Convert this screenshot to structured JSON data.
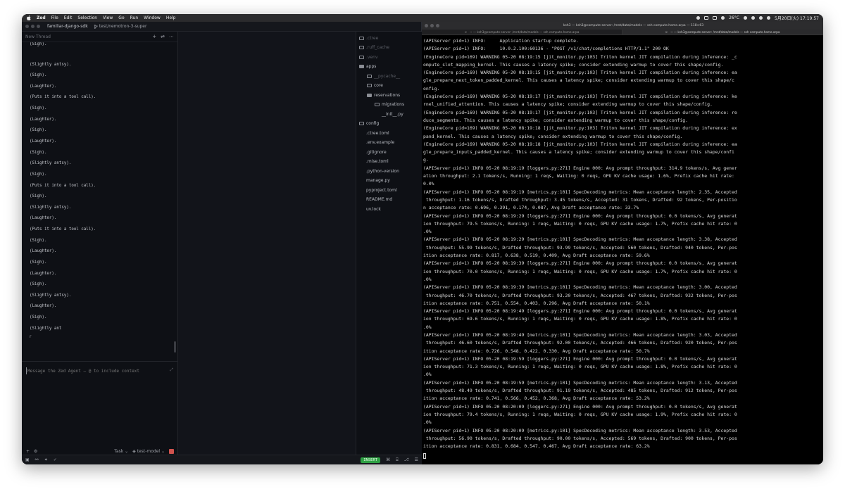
{
  "menubar": {
    "app": "Zed",
    "items": [
      "File",
      "Edit",
      "Selection",
      "View",
      "Go",
      "Run",
      "Window",
      "Help"
    ],
    "temperature": "26°C",
    "datetime": "5月20日(火) 17:19:57"
  },
  "zed": {
    "project": "familiar-django-sdk",
    "branch": "test/nemotron-3-super",
    "thread_title": "New Thread",
    "header_actions": [
      "+",
      "⇌",
      "⋯"
    ],
    "messages": [
      "(Sigh).",
      "(Slightly antsy).",
      "(Sigh).",
      "(Laughter).",
      "(Puts it into a tool call).",
      "(Sigh).",
      "(Laughter).",
      "(Sigh).",
      "(Laughter).",
      "(Sigh).",
      "(Slightly antsy).",
      "(Sigh).",
      "(Puts it into a tool call).",
      "(Sigh).",
      "(Slightly antsy).",
      "(Laughter).",
      "(Puts it into a tool call).",
      "(Sigh).",
      "(Laughter).",
      "(Sigh).",
      "(Laughter).",
      "(Sigh).",
      "(Slightly antsy).",
      "(Laughter).",
      "(Sigh).",
      "(Slightly ant"
    ],
    "cursor_glyph": "r",
    "composer_placeholder": "Message the Zed Agent — @ to include context",
    "footer": {
      "mode": "Task",
      "model": "test-model"
    },
    "project_tree": [
      {
        "name": ".ctree",
        "type": "folder",
        "dim": true,
        "depth": 0
      },
      {
        "name": ".ruff_cache",
        "type": "folder",
        "dim": true,
        "depth": 0
      },
      {
        "name": ".venv",
        "type": "folder",
        "dim": true,
        "depth": 0
      },
      {
        "name": "apps",
        "type": "folder-open",
        "dim": false,
        "depth": 0
      },
      {
        "name": "__pycache__",
        "type": "folder",
        "dim": true,
        "depth": 1
      },
      {
        "name": "core",
        "type": "folder",
        "dim": false,
        "depth": 1
      },
      {
        "name": "reservations",
        "type": "folder-open",
        "dim": false,
        "depth": 1
      },
      {
        "name": "migrations",
        "type": "folder",
        "dim": false,
        "depth": 2
      },
      {
        "name": "__init__.py",
        "type": "file",
        "dim": false,
        "depth": 2
      },
      {
        "name": "config",
        "type": "folder",
        "dim": false,
        "depth": 0
      },
      {
        "name": ".ctree.toml",
        "type": "file",
        "dim": false,
        "depth": 0
      },
      {
        "name": ".env.example",
        "type": "file",
        "dim": false,
        "depth": 0
      },
      {
        "name": ".gitignore",
        "type": "file",
        "dim": false,
        "depth": 0
      },
      {
        "name": ".mise.toml",
        "type": "file",
        "dim": false,
        "depth": 0
      },
      {
        "name": ".python-version",
        "type": "file",
        "dim": false,
        "depth": 0
      },
      {
        "name": "manage.py",
        "type": "file",
        "dim": false,
        "depth": 0
      },
      {
        "name": "pyproject.toml",
        "type": "file",
        "dim": false,
        "depth": 0
      },
      {
        "name": "README.md",
        "type": "file",
        "dim": false,
        "depth": 0
      },
      {
        "name": "uv.lock",
        "type": "file",
        "dim": false,
        "depth": 0
      }
    ],
    "status": {
      "mode": "INSERT"
    }
  },
  "terminal": {
    "window_title": "ksh3 — ksh3@compute-server: /mnt/data/models — ssh compute.home.arpa — 118×63",
    "tabs": [
      "~ — ksh3@compute-server: /mnt/data/models — ssh compute.home.arpa",
      "~ — ksh3@compute-server: /mnt/data/models — ssh compute.home.arpa"
    ],
    "lines": [
      "(APIServer pid=1) INFO:     Application startup complete.",
      "(APIServer pid=1) INFO:     10.0.2.100:60136 - \"POST /v1/chat/completions HTTP/1.1\" 200 OK",
      "(EngineCore pid=169) WARNING 05-20 08:19:15 [jit_monitor.py:103] Triton kernel JIT compilation during inference: _c",
      "ompute_slot_mapping_kernel. This causes a latency spike; consider extending warmup to cover this shape/config.",
      "(EngineCore pid=169) WARNING 05-20 08:19:15 [jit_monitor.py:103] Triton kernel JIT compilation during inference: ea",
      "gle_prepare_next_token_padded_kernel. This causes a latency spike; consider extending warmup to cover this shape/c",
      "onfig.",
      "(EngineCore pid=169) WARNING 05-20 08:19:17 [jit_monitor.py:103] Triton kernel JIT compilation during inference: ke",
      "rnel_unified_attention. This causes a latency spike; consider extending warmup to cover this shape/config.",
      "(EngineCore pid=169) WARNING 05-20 08:19:17 [jit_monitor.py:103] Triton kernel JIT compilation during inference: re",
      "duce_segments. This causes a latency spike; consider extending warmup to cover this shape/config.",
      "(EngineCore pid=169) WARNING 05-20 08:19:18 [jit_monitor.py:103] Triton kernel JIT compilation during inference: ex",
      "pand_kernel. This causes a latency spike; consider extending warmup to cover this shape/config.",
      "(EngineCore pid=169) WARNING 05-20 08:19:18 [jit_monitor.py:103] Triton kernel JIT compilation during inference: ea",
      "gle_prepare_inputs_padded_kernel. This causes a latency spike; consider extending warmup to cover this shape/confi",
      "g.",
      "(APIServer pid=1) INFO 05-20 08:19:19 [loggers.py:271] Engine 000: Avg prompt throughput: 314.9 tokens/s, Avg gener",
      "ation throughput: 2.1 tokens/s, Running: 1 reqs, Waiting: 0 reqs, GPU KV cache usage: 1.6%, Prefix cache hit rate:",
      "0.0%",
      "(APIServer pid=1) INFO 05-20 08:19:19 [metrics.py:101] SpecDecoding metrics: Mean acceptance length: 2.35, Accepted",
      " throughput: 1.16 tokens/s, Drafted throughput: 3.45 tokens/s, Accepted: 31 tokens, Drafted: 92 tokens, Per-positio",
      "n acceptance rate: 0.696, 0.391, 0.174, 0.087, Avg Draft acceptance rate: 33.7%",
      "(APIServer pid=1) INFO 05-20 08:19:29 [loggers.py:271] Engine 000: Avg prompt throughput: 0.0 tokens/s, Avg generat",
      "ion throughput: 79.5 tokens/s, Running: 1 reqs, Waiting: 0 reqs, GPU KV cache usage: 1.7%, Prefix cache hit rate: 0",
      ".0%",
      "(APIServer pid=1) INFO 05-20 08:19:29 [metrics.py:101] SpecDecoding metrics: Mean acceptance length: 3.38, Accepted",
      " throughput: 55.99 tokens/s, Drafted throughput: 93.99 tokens/s, Accepted: 560 tokens, Drafted: 940 tokens, Per-pos",
      "ition acceptance rate: 0.817, 0.638, 0.519, 0.409, Avg Draft acceptance rate: 59.6%",
      "(APIServer pid=1) INFO 05-20 08:19:39 [loggers.py:271] Engine 000: Avg prompt throughput: 0.0 tokens/s, Avg generat",
      "ion throughput: 70.0 tokens/s, Running: 1 reqs, Waiting: 0 reqs, GPU KV cache usage: 1.7%, Prefix cache hit rate: 0",
      ".0%",
      "(APIServer pid=1) INFO 05-20 08:19:39 [metrics.py:101] SpecDecoding metrics: Mean acceptance length: 3.00, Accepted",
      " throughput: 46.70 tokens/s, Drafted throughput: 93.20 tokens/s, Accepted: 467 tokens, Drafted: 932 tokens, Per-pos",
      "ition acceptance rate: 0.751, 0.554, 0.403, 0.296, Avg Draft acceptance rate: 50.1%",
      "(APIServer pid=1) INFO 05-20 08:19:49 [loggers.py:271] Engine 000: Avg prompt throughput: 0.0 tokens/s, Avg generat",
      "ion throughput: 69.6 tokens/s, Running: 1 reqs, Waiting: 0 reqs, GPU KV cache usage: 1.8%, Prefix cache hit rate: 0",
      ".0%",
      "(APIServer pid=1) INFO 05-20 08:19:49 [metrics.py:101] SpecDecoding metrics: Mean acceptance length: 3.03, Accepted",
      " throughput: 46.60 tokens/s, Drafted throughput: 92.00 tokens/s, Accepted: 466 tokens, Drafted: 920 tokens, Per-pos",
      "ition acceptance rate: 0.726, 0.548, 0.422, 0.330, Avg Draft acceptance rate: 50.7%",
      "(APIServer pid=1) INFO 05-20 08:19:59 [loggers.py:271] Engine 000: Avg prompt throughput: 0.0 tokens/s, Avg generat",
      "ion throughput: 71.3 tokens/s, Running: 1 reqs, Waiting: 0 reqs, GPU KV cache usage: 1.8%, Prefix cache hit rate: 0",
      ".0%",
      "(APIServer pid=1) INFO 05-20 08:19:59 [metrics.py:101] SpecDecoding metrics: Mean acceptance length: 3.13, Accepted",
      " throughput: 48.49 tokens/s, Drafted throughput: 91.19 tokens/s, Accepted: 485 tokens, Drafted: 912 tokens, Per-pos",
      "ition acceptance rate: 0.741, 0.566, 0.452, 0.368, Avg Draft acceptance rate: 53.2%",
      "(APIServer pid=1) INFO 05-20 08:20:09 [loggers.py:271] Engine 000: Avg prompt throughput: 0.0 tokens/s, Avg generat",
      "ion throughput: 79.4 tokens/s, Running: 1 reqs, Waiting: 0 reqs, GPU KV cache usage: 1.9%, Prefix cache hit rate: 0",
      ".0%",
      "(APIServer pid=1) INFO 05-20 08:20:09 [metrics.py:101] SpecDecoding metrics: Mean acceptance length: 3.53, Accepted",
      " throughput: 56.90 tokens/s, Drafted throughput: 90.00 tokens/s, Accepted: 569 tokens, Drafted: 900 tokens, Per-pos",
      "ition acceptance rate: 0.831, 0.684, 0.547, 0.467, Avg Draft acceptance rate: 63.2%"
    ]
  }
}
